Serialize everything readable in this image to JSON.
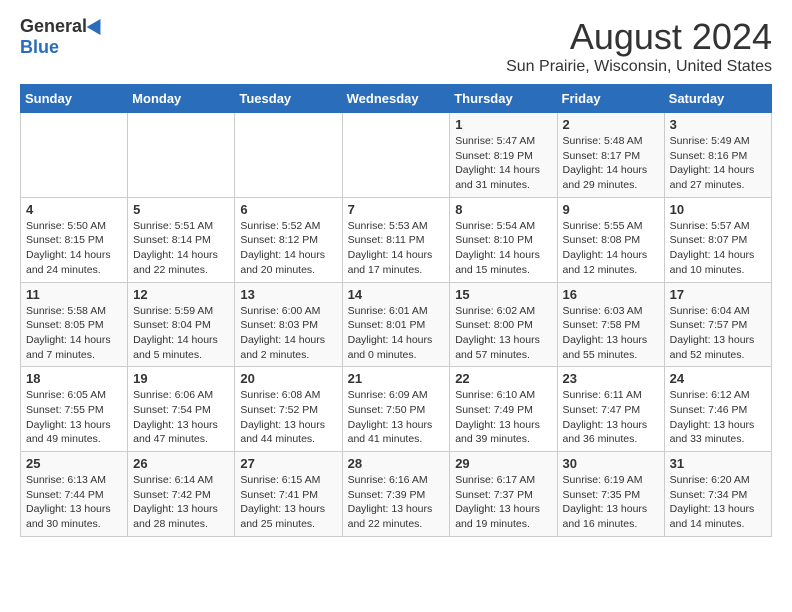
{
  "logo": {
    "general": "General",
    "blue": "Blue"
  },
  "title": "August 2024",
  "location": "Sun Prairie, Wisconsin, United States",
  "days_of_week": [
    "Sunday",
    "Monday",
    "Tuesday",
    "Wednesday",
    "Thursday",
    "Friday",
    "Saturday"
  ],
  "weeks": [
    [
      {
        "day": "",
        "info": ""
      },
      {
        "day": "",
        "info": ""
      },
      {
        "day": "",
        "info": ""
      },
      {
        "day": "",
        "info": ""
      },
      {
        "day": "1",
        "info": "Sunrise: 5:47 AM\nSunset: 8:19 PM\nDaylight: 14 hours\nand 31 minutes."
      },
      {
        "day": "2",
        "info": "Sunrise: 5:48 AM\nSunset: 8:17 PM\nDaylight: 14 hours\nand 29 minutes."
      },
      {
        "day": "3",
        "info": "Sunrise: 5:49 AM\nSunset: 8:16 PM\nDaylight: 14 hours\nand 27 minutes."
      }
    ],
    [
      {
        "day": "4",
        "info": "Sunrise: 5:50 AM\nSunset: 8:15 PM\nDaylight: 14 hours\nand 24 minutes."
      },
      {
        "day": "5",
        "info": "Sunrise: 5:51 AM\nSunset: 8:14 PM\nDaylight: 14 hours\nand 22 minutes."
      },
      {
        "day": "6",
        "info": "Sunrise: 5:52 AM\nSunset: 8:12 PM\nDaylight: 14 hours\nand 20 minutes."
      },
      {
        "day": "7",
        "info": "Sunrise: 5:53 AM\nSunset: 8:11 PM\nDaylight: 14 hours\nand 17 minutes."
      },
      {
        "day": "8",
        "info": "Sunrise: 5:54 AM\nSunset: 8:10 PM\nDaylight: 14 hours\nand 15 minutes."
      },
      {
        "day": "9",
        "info": "Sunrise: 5:55 AM\nSunset: 8:08 PM\nDaylight: 14 hours\nand 12 minutes."
      },
      {
        "day": "10",
        "info": "Sunrise: 5:57 AM\nSunset: 8:07 PM\nDaylight: 14 hours\nand 10 minutes."
      }
    ],
    [
      {
        "day": "11",
        "info": "Sunrise: 5:58 AM\nSunset: 8:05 PM\nDaylight: 14 hours\nand 7 minutes."
      },
      {
        "day": "12",
        "info": "Sunrise: 5:59 AM\nSunset: 8:04 PM\nDaylight: 14 hours\nand 5 minutes."
      },
      {
        "day": "13",
        "info": "Sunrise: 6:00 AM\nSunset: 8:03 PM\nDaylight: 14 hours\nand 2 minutes."
      },
      {
        "day": "14",
        "info": "Sunrise: 6:01 AM\nSunset: 8:01 PM\nDaylight: 14 hours\nand 0 minutes."
      },
      {
        "day": "15",
        "info": "Sunrise: 6:02 AM\nSunset: 8:00 PM\nDaylight: 13 hours\nand 57 minutes."
      },
      {
        "day": "16",
        "info": "Sunrise: 6:03 AM\nSunset: 7:58 PM\nDaylight: 13 hours\nand 55 minutes."
      },
      {
        "day": "17",
        "info": "Sunrise: 6:04 AM\nSunset: 7:57 PM\nDaylight: 13 hours\nand 52 minutes."
      }
    ],
    [
      {
        "day": "18",
        "info": "Sunrise: 6:05 AM\nSunset: 7:55 PM\nDaylight: 13 hours\nand 49 minutes."
      },
      {
        "day": "19",
        "info": "Sunrise: 6:06 AM\nSunset: 7:54 PM\nDaylight: 13 hours\nand 47 minutes."
      },
      {
        "day": "20",
        "info": "Sunrise: 6:08 AM\nSunset: 7:52 PM\nDaylight: 13 hours\nand 44 minutes."
      },
      {
        "day": "21",
        "info": "Sunrise: 6:09 AM\nSunset: 7:50 PM\nDaylight: 13 hours\nand 41 minutes."
      },
      {
        "day": "22",
        "info": "Sunrise: 6:10 AM\nSunset: 7:49 PM\nDaylight: 13 hours\nand 39 minutes."
      },
      {
        "day": "23",
        "info": "Sunrise: 6:11 AM\nSunset: 7:47 PM\nDaylight: 13 hours\nand 36 minutes."
      },
      {
        "day": "24",
        "info": "Sunrise: 6:12 AM\nSunset: 7:46 PM\nDaylight: 13 hours\nand 33 minutes."
      }
    ],
    [
      {
        "day": "25",
        "info": "Sunrise: 6:13 AM\nSunset: 7:44 PM\nDaylight: 13 hours\nand 30 minutes."
      },
      {
        "day": "26",
        "info": "Sunrise: 6:14 AM\nSunset: 7:42 PM\nDaylight: 13 hours\nand 28 minutes."
      },
      {
        "day": "27",
        "info": "Sunrise: 6:15 AM\nSunset: 7:41 PM\nDaylight: 13 hours\nand 25 minutes."
      },
      {
        "day": "28",
        "info": "Sunrise: 6:16 AM\nSunset: 7:39 PM\nDaylight: 13 hours\nand 22 minutes."
      },
      {
        "day": "29",
        "info": "Sunrise: 6:17 AM\nSunset: 7:37 PM\nDaylight: 13 hours\nand 19 minutes."
      },
      {
        "day": "30",
        "info": "Sunrise: 6:19 AM\nSunset: 7:35 PM\nDaylight: 13 hours\nand 16 minutes."
      },
      {
        "day": "31",
        "info": "Sunrise: 6:20 AM\nSunset: 7:34 PM\nDaylight: 13 hours\nand 14 minutes."
      }
    ]
  ]
}
